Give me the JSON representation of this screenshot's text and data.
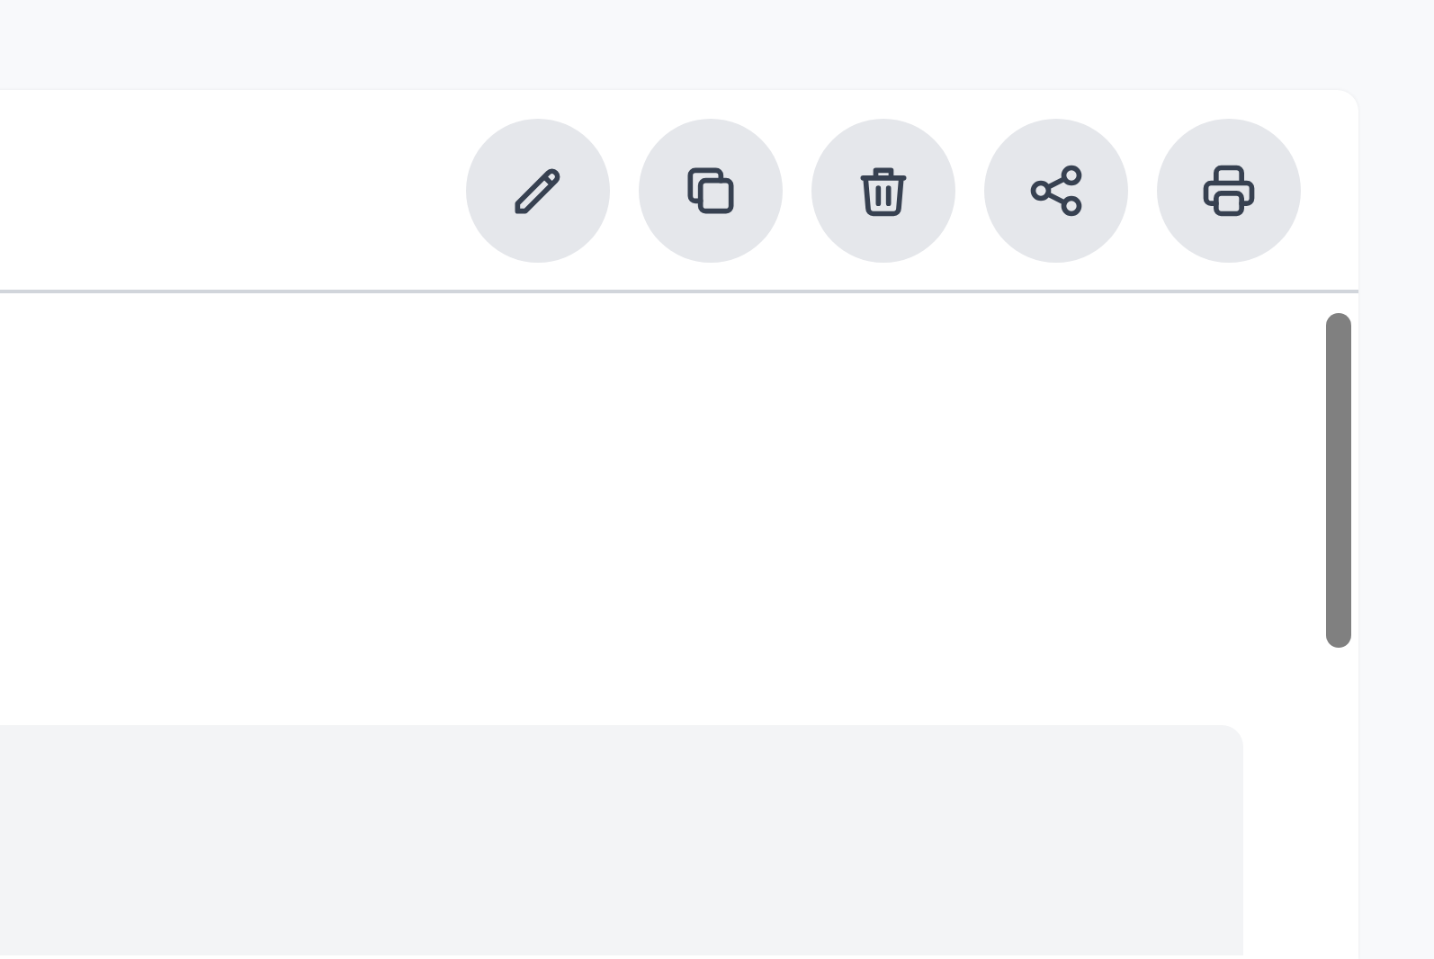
{
  "toolbar": {
    "buttons": [
      {
        "kind": "edit"
      },
      {
        "kind": "copy"
      },
      {
        "kind": "delete"
      },
      {
        "kind": "share"
      },
      {
        "kind": "print"
      }
    ]
  }
}
